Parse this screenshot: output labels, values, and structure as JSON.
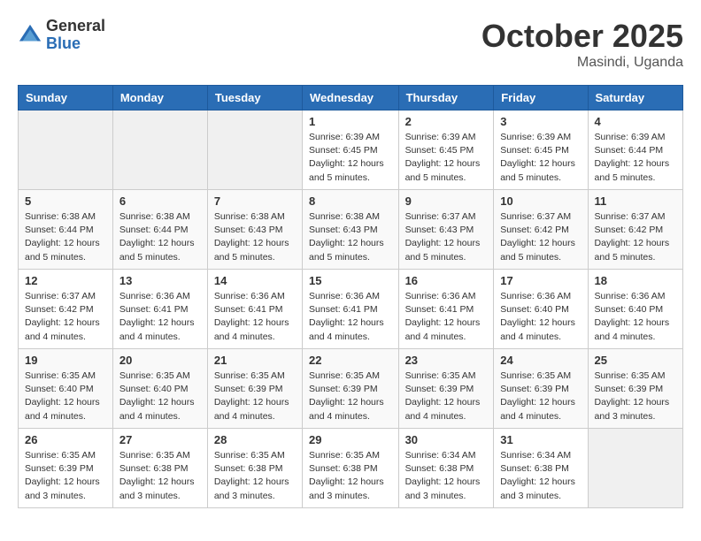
{
  "header": {
    "logo_general": "General",
    "logo_blue": "Blue",
    "month_title": "October 2025",
    "location": "Masindi, Uganda"
  },
  "weekdays": [
    "Sunday",
    "Monday",
    "Tuesday",
    "Wednesday",
    "Thursday",
    "Friday",
    "Saturday"
  ],
  "weeks": [
    [
      {
        "day": "",
        "info": ""
      },
      {
        "day": "",
        "info": ""
      },
      {
        "day": "",
        "info": ""
      },
      {
        "day": "1",
        "info": "Sunrise: 6:39 AM\nSunset: 6:45 PM\nDaylight: 12 hours\nand 5 minutes."
      },
      {
        "day": "2",
        "info": "Sunrise: 6:39 AM\nSunset: 6:45 PM\nDaylight: 12 hours\nand 5 minutes."
      },
      {
        "day": "3",
        "info": "Sunrise: 6:39 AM\nSunset: 6:45 PM\nDaylight: 12 hours\nand 5 minutes."
      },
      {
        "day": "4",
        "info": "Sunrise: 6:39 AM\nSunset: 6:44 PM\nDaylight: 12 hours\nand 5 minutes."
      }
    ],
    [
      {
        "day": "5",
        "info": "Sunrise: 6:38 AM\nSunset: 6:44 PM\nDaylight: 12 hours\nand 5 minutes."
      },
      {
        "day": "6",
        "info": "Sunrise: 6:38 AM\nSunset: 6:44 PM\nDaylight: 12 hours\nand 5 minutes."
      },
      {
        "day": "7",
        "info": "Sunrise: 6:38 AM\nSunset: 6:43 PM\nDaylight: 12 hours\nand 5 minutes."
      },
      {
        "day": "8",
        "info": "Sunrise: 6:38 AM\nSunset: 6:43 PM\nDaylight: 12 hours\nand 5 minutes."
      },
      {
        "day": "9",
        "info": "Sunrise: 6:37 AM\nSunset: 6:43 PM\nDaylight: 12 hours\nand 5 minutes."
      },
      {
        "day": "10",
        "info": "Sunrise: 6:37 AM\nSunset: 6:42 PM\nDaylight: 12 hours\nand 5 minutes."
      },
      {
        "day": "11",
        "info": "Sunrise: 6:37 AM\nSunset: 6:42 PM\nDaylight: 12 hours\nand 5 minutes."
      }
    ],
    [
      {
        "day": "12",
        "info": "Sunrise: 6:37 AM\nSunset: 6:42 PM\nDaylight: 12 hours\nand 4 minutes."
      },
      {
        "day": "13",
        "info": "Sunrise: 6:36 AM\nSunset: 6:41 PM\nDaylight: 12 hours\nand 4 minutes."
      },
      {
        "day": "14",
        "info": "Sunrise: 6:36 AM\nSunset: 6:41 PM\nDaylight: 12 hours\nand 4 minutes."
      },
      {
        "day": "15",
        "info": "Sunrise: 6:36 AM\nSunset: 6:41 PM\nDaylight: 12 hours\nand 4 minutes."
      },
      {
        "day": "16",
        "info": "Sunrise: 6:36 AM\nSunset: 6:41 PM\nDaylight: 12 hours\nand 4 minutes."
      },
      {
        "day": "17",
        "info": "Sunrise: 6:36 AM\nSunset: 6:40 PM\nDaylight: 12 hours\nand 4 minutes."
      },
      {
        "day": "18",
        "info": "Sunrise: 6:36 AM\nSunset: 6:40 PM\nDaylight: 12 hours\nand 4 minutes."
      }
    ],
    [
      {
        "day": "19",
        "info": "Sunrise: 6:35 AM\nSunset: 6:40 PM\nDaylight: 12 hours\nand 4 minutes."
      },
      {
        "day": "20",
        "info": "Sunrise: 6:35 AM\nSunset: 6:40 PM\nDaylight: 12 hours\nand 4 minutes."
      },
      {
        "day": "21",
        "info": "Sunrise: 6:35 AM\nSunset: 6:39 PM\nDaylight: 12 hours\nand 4 minutes."
      },
      {
        "day": "22",
        "info": "Sunrise: 6:35 AM\nSunset: 6:39 PM\nDaylight: 12 hours\nand 4 minutes."
      },
      {
        "day": "23",
        "info": "Sunrise: 6:35 AM\nSunset: 6:39 PM\nDaylight: 12 hours\nand 4 minutes."
      },
      {
        "day": "24",
        "info": "Sunrise: 6:35 AM\nSunset: 6:39 PM\nDaylight: 12 hours\nand 4 minutes."
      },
      {
        "day": "25",
        "info": "Sunrise: 6:35 AM\nSunset: 6:39 PM\nDaylight: 12 hours\nand 3 minutes."
      }
    ],
    [
      {
        "day": "26",
        "info": "Sunrise: 6:35 AM\nSunset: 6:39 PM\nDaylight: 12 hours\nand 3 minutes."
      },
      {
        "day": "27",
        "info": "Sunrise: 6:35 AM\nSunset: 6:38 PM\nDaylight: 12 hours\nand 3 minutes."
      },
      {
        "day": "28",
        "info": "Sunrise: 6:35 AM\nSunset: 6:38 PM\nDaylight: 12 hours\nand 3 minutes."
      },
      {
        "day": "29",
        "info": "Sunrise: 6:35 AM\nSunset: 6:38 PM\nDaylight: 12 hours\nand 3 minutes."
      },
      {
        "day": "30",
        "info": "Sunrise: 6:34 AM\nSunset: 6:38 PM\nDaylight: 12 hours\nand 3 minutes."
      },
      {
        "day": "31",
        "info": "Sunrise: 6:34 AM\nSunset: 6:38 PM\nDaylight: 12 hours\nand 3 minutes."
      },
      {
        "day": "",
        "info": ""
      }
    ]
  ]
}
